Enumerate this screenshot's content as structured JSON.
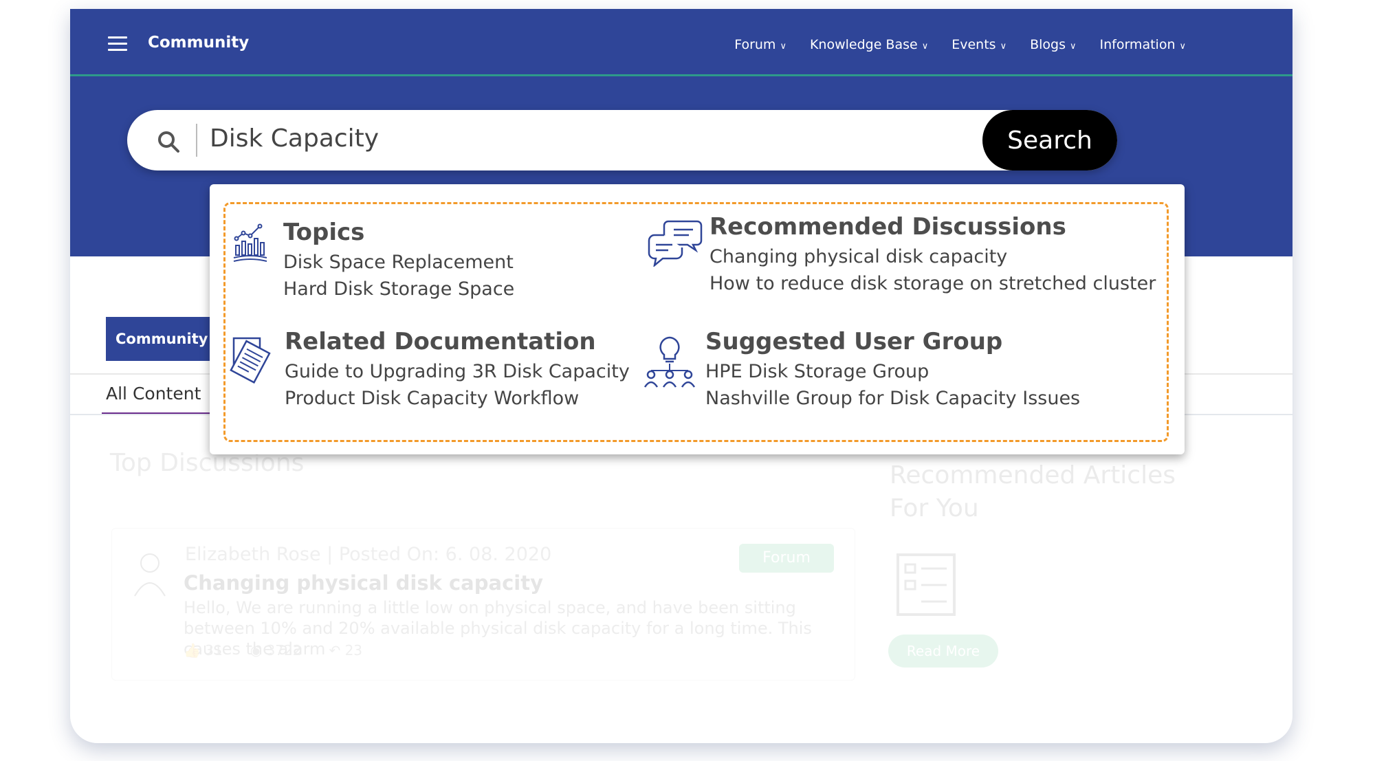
{
  "nav": {
    "brand": "Community",
    "items": [
      "Forum",
      "Knowledge Base",
      "Events",
      "Blogs",
      "Information"
    ]
  },
  "search": {
    "query": "Disk Capacity",
    "button_label": "Search"
  },
  "page": {
    "community_tab": "Community",
    "all_content_tab": "All Content",
    "top_discussions_title": "Top Discussions",
    "discussion": {
      "meta": "Elizabeth Rose | Posted On: 6. 08. 2020",
      "badge": "Forum",
      "title": "Changing physical disk capacity",
      "body": "Hello, We are running a little low on physical space, and have been sitting between 10% and 20% available physical disk capacity for a long time. This causes the alarm",
      "likes": "31",
      "views": "3722",
      "replies": "23"
    },
    "recommended_articles_title": "Recommended Articles For You",
    "read_more": "Read More"
  },
  "suggestions": {
    "topics": {
      "title": "Topics",
      "icon": "chart-book-icon",
      "items": [
        "Disk Space Replacement",
        "Hard Disk Storage Space"
      ]
    },
    "recommended_discussions": {
      "title": "Recommended Discussions",
      "icon": "chat-bubbles-icon",
      "items": [
        "Changing physical disk capacity",
        "How to reduce disk storage on stretched cluster"
      ]
    },
    "related_documentation": {
      "title": "Related Documentation",
      "icon": "document-icon",
      "items": [
        "Guide to Upgrading 3R Disk Capacity",
        "Product Disk Capacity Workflow"
      ]
    },
    "suggested_user_group": {
      "title": "Suggested User Group",
      "icon": "lightbulb-group-icon",
      "items": [
        "HPE Disk Storage Group",
        "Nashville Group for Disk Capacity Issues"
      ]
    }
  },
  "colors": {
    "brand_blue": "#2f4598",
    "accent_orange": "#f39a2a",
    "button_black": "#000000",
    "badge_green": "#35b56c"
  }
}
